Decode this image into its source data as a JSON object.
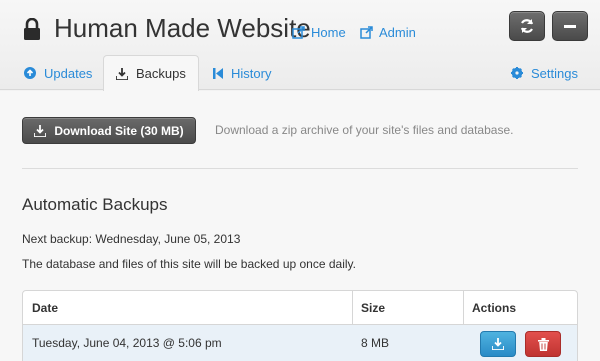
{
  "header": {
    "title": "Human Made Website",
    "links": [
      {
        "label": "Home",
        "icon": "external-link-icon"
      },
      {
        "label": "Admin",
        "icon": "external-link-icon"
      }
    ],
    "buttons": [
      {
        "icon": "refresh-icon"
      },
      {
        "icon": "minimize-icon"
      }
    ]
  },
  "tabs": [
    {
      "label": "Updates",
      "icon": "arrow-circle-up-icon",
      "active": false
    },
    {
      "label": "Backups",
      "icon": "download-icon",
      "active": true
    },
    {
      "label": "History",
      "icon": "skip-back-icon",
      "active": false
    },
    {
      "label": "Settings",
      "icon": "gear-icon",
      "active": false
    }
  ],
  "download": {
    "button_label": "Download Site (30 MB)",
    "description": "Download a zip archive of your site's files and database."
  },
  "automatic": {
    "title": "Automatic Backups",
    "next_backup": "Next backup: Wednesday, June 05, 2013",
    "note": "The database and files of this site will be backed up once daily."
  },
  "table": {
    "headers": [
      "Date",
      "Size",
      "Actions"
    ],
    "rows": [
      {
        "date": "Tuesday, June 04, 2013 @ 5:06 pm",
        "size": "8 MB"
      }
    ]
  },
  "colors": {
    "link": "#2a8bd8",
    "dark_button": "#4b4b4b",
    "download_action": "#2a8bc6",
    "delete_action": "#c03431",
    "row_highlight": "#e9f1f8"
  }
}
